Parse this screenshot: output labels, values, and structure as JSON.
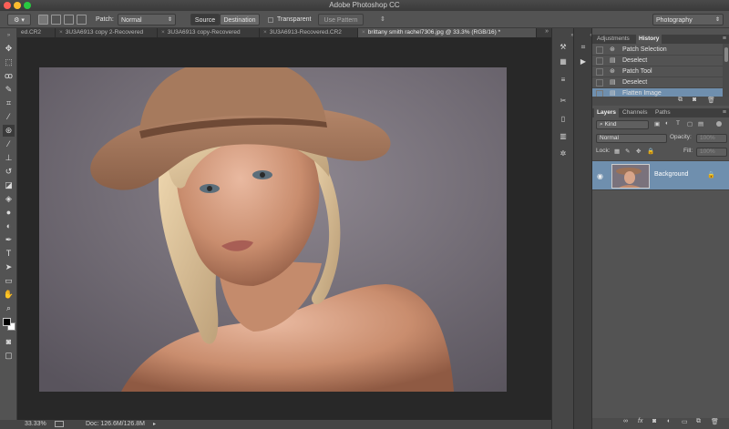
{
  "window": {
    "title": "Adobe Photoshop CC"
  },
  "options_bar": {
    "patch_label": "Patch:",
    "patch_mode": "Normal",
    "source_label": "Source",
    "destination_label": "Destination",
    "transparent_label": "Transparent",
    "use_pattern_label": "Use Pattern",
    "workspace": "Photography"
  },
  "tabs": [
    {
      "label": "ed.CR2"
    },
    {
      "label": "3U3A6913 copy 2-Recovered"
    },
    {
      "label": "3U3A6913 copy-Recovered"
    },
    {
      "label": "3U3A6913-Recovered.CR2"
    },
    {
      "label": "brittany smith rachel7306.jpg @ 33.3% (RGB/16) *"
    }
  ],
  "status_bar": {
    "zoom": "33.33%",
    "doc": "Doc: 126.6M/126.8M"
  },
  "adjust_panel": {
    "tabs": [
      "Adjustments",
      "History"
    ],
    "active_tab": "History",
    "history": [
      "Patch Selection",
      "Deselect",
      "Patch Tool",
      "Deselect",
      "Flatten Image"
    ]
  },
  "layers_panel": {
    "tabs": [
      "Layers",
      "Channels",
      "Paths"
    ],
    "filter": "Kind",
    "blend_mode": "Normal",
    "opacity_label": "Opacity:",
    "opacity_value": "100%",
    "lock_label": "Lock:",
    "fill_label": "Fill:",
    "fill_value": "100%",
    "layers": [
      {
        "name": "Background",
        "selected": true
      }
    ]
  },
  "colors": {
    "accent": "#6f8fae",
    "panel": "#535353",
    "canvas": "#282828"
  }
}
